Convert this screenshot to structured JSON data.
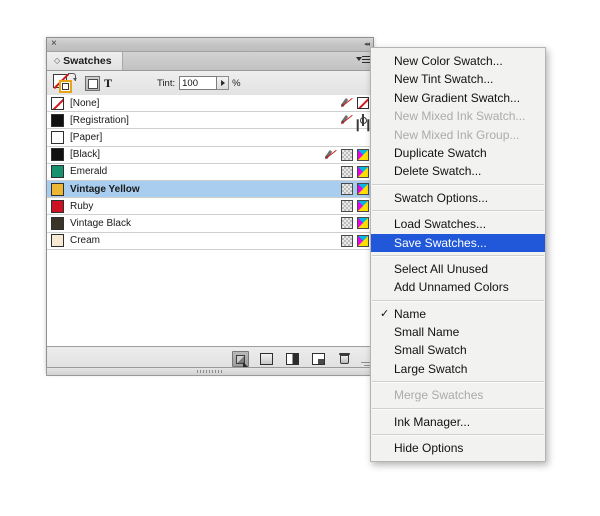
{
  "panel": {
    "close_label": "×",
    "collapse_label": "◂◂",
    "tab_grip": "◇",
    "tab_label": "Swatches",
    "toolbar": {
      "tint_label": "Tint:",
      "tint_value": "100",
      "tint_percent": "%",
      "apply_text_label": "T"
    },
    "rows": [
      {
        "name": "[None]",
        "color": "none",
        "icons": [
          "pencil-strike",
          "none-box"
        ]
      },
      {
        "name": "[Registration]",
        "color": "#101010",
        "icons": [
          "pencil-strike",
          "registration"
        ]
      },
      {
        "name": "[Paper]",
        "color": "#ffffff",
        "icons": []
      },
      {
        "name": "[Black]",
        "color": "#101010",
        "icons": [
          "pencil-strike",
          "tint-grid",
          "cmyk"
        ]
      },
      {
        "name": "Emerald",
        "color": "#16926e",
        "icons": [
          "tint-grid",
          "cmyk"
        ]
      },
      {
        "name": "Vintage Yellow",
        "color": "#eeb733",
        "icons": [
          "tint-grid",
          "cmyk"
        ],
        "selected": true
      },
      {
        "name": "Ruby",
        "color": "#cc1125",
        "icons": [
          "tint-grid",
          "cmyk"
        ]
      },
      {
        "name": "Vintage Black",
        "color": "#3a3328",
        "icons": [
          "tint-grid",
          "cmyk"
        ]
      },
      {
        "name": "Cream",
        "color": "#f7e9d2",
        "icons": [
          "tint-grid",
          "cmyk"
        ]
      }
    ],
    "bottom_buttons": [
      {
        "name": "color-theme-button",
        "icon": "theme",
        "active": true
      },
      {
        "name": "show-color-swatches-button",
        "icon": "solid",
        "active": false
      },
      {
        "name": "show-gradient-swatches-button",
        "icon": "gradient",
        "active": false
      },
      {
        "name": "new-swatch-button",
        "icon": "new",
        "active": false
      },
      {
        "name": "delete-swatch-button",
        "icon": "trash",
        "active": false
      }
    ]
  },
  "menu": {
    "items": [
      {
        "label": "New Color Swatch...",
        "state": "normal"
      },
      {
        "label": "New Tint Swatch...",
        "state": "normal"
      },
      {
        "label": "New Gradient Swatch...",
        "state": "normal"
      },
      {
        "label": "New Mixed Ink Swatch...",
        "state": "disabled"
      },
      {
        "label": "New Mixed Ink Group...",
        "state": "disabled"
      },
      {
        "label": "Duplicate Swatch",
        "state": "normal"
      },
      {
        "label": "Delete Swatch...",
        "state": "normal"
      },
      {
        "separator": true
      },
      {
        "label": "Swatch Options...",
        "state": "normal"
      },
      {
        "separator": true
      },
      {
        "label": "Load Swatches...",
        "state": "normal"
      },
      {
        "label": "Save Swatches...",
        "state": "highlighted"
      },
      {
        "separator": true
      },
      {
        "label": "Select All Unused",
        "state": "normal"
      },
      {
        "label": "Add Unnamed Colors",
        "state": "normal"
      },
      {
        "separator": true
      },
      {
        "label": "Name",
        "state": "normal",
        "checked": true
      },
      {
        "label": "Small Name",
        "state": "normal"
      },
      {
        "label": "Small Swatch",
        "state": "normal"
      },
      {
        "label": "Large Swatch",
        "state": "normal"
      },
      {
        "separator": true
      },
      {
        "label": "Merge Swatches",
        "state": "disabled"
      },
      {
        "separator": true
      },
      {
        "label": "Ink Manager...",
        "state": "normal"
      },
      {
        "separator": true
      },
      {
        "label": "Hide Options",
        "state": "normal"
      }
    ],
    "check_glyph": "✓"
  }
}
